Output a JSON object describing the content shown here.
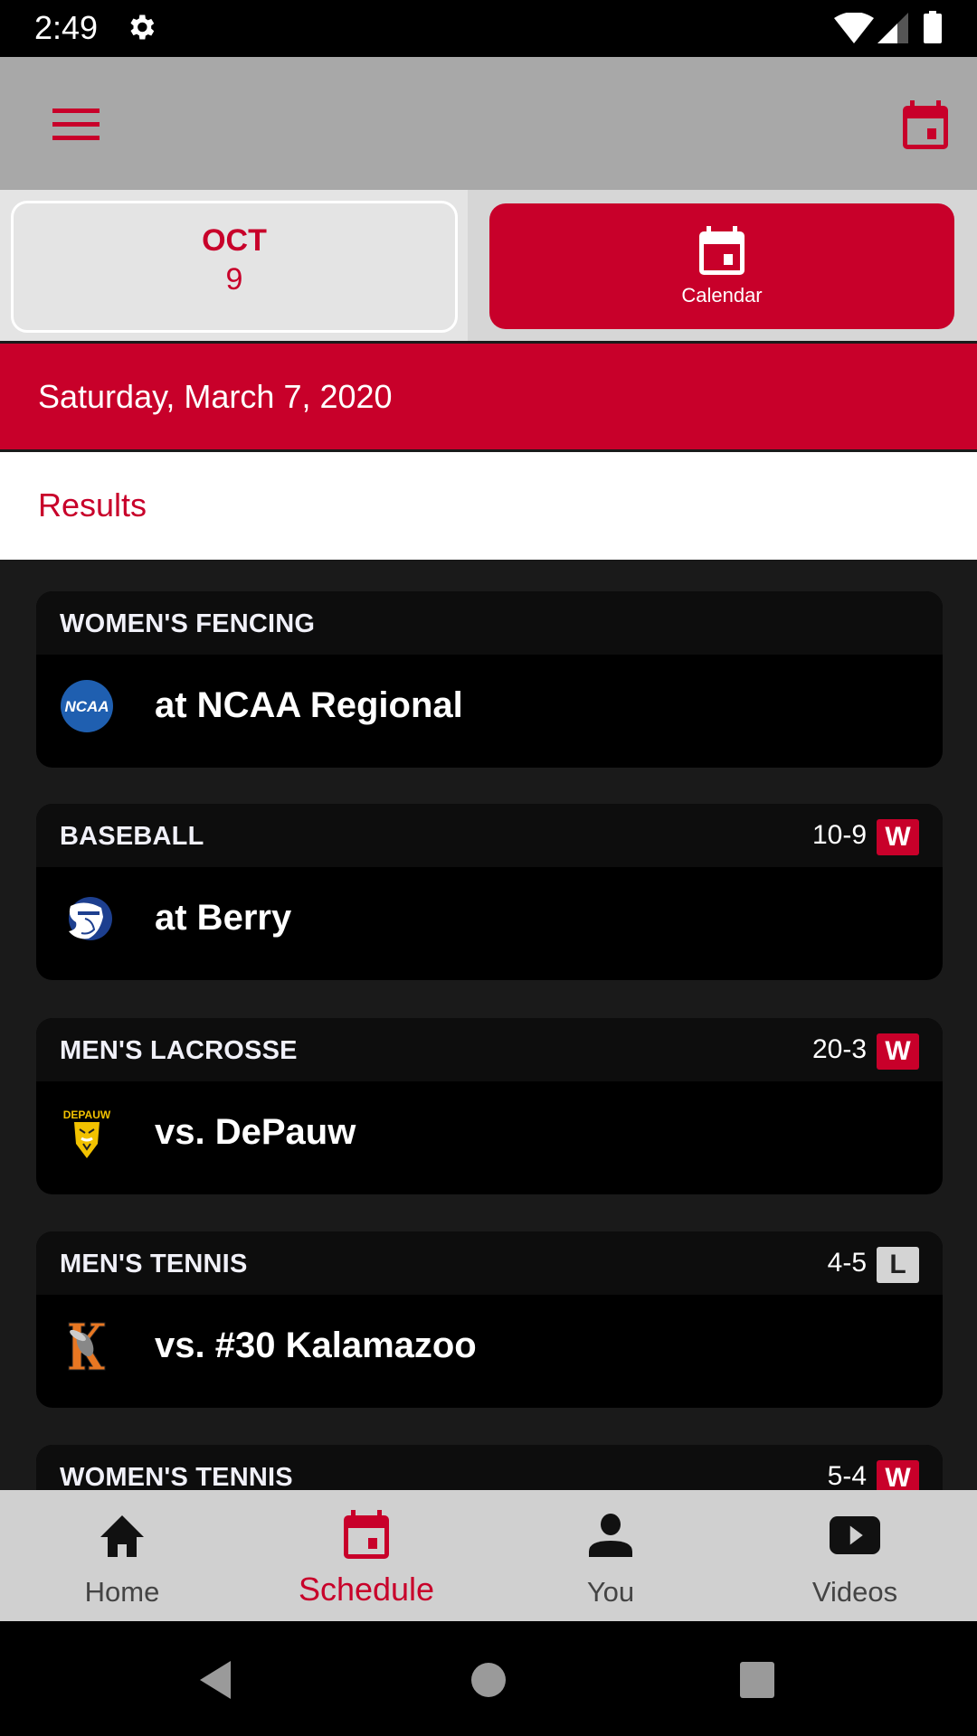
{
  "status_bar": {
    "time": "2:49",
    "icons": [
      "gear-icon",
      "wifi-icon",
      "cell-signal-icon",
      "battery-icon"
    ]
  },
  "app_bar": {
    "left_icon": "hamburger-menu-icon",
    "right_icon": "calendar-icon"
  },
  "date_selector": {
    "month": "OCT",
    "day": "9",
    "calendar_button_label": "Calendar"
  },
  "selected_date": "Saturday, March 7, 2020",
  "section_title": "Results",
  "colors": {
    "accent": "#c8002a",
    "app_bar": "#a8a8a8",
    "content_bg": "#1a1a1a",
    "win_badge": "#c8002a",
    "loss_badge": "#d4d4d4"
  },
  "games": [
    {
      "sport": "WOMEN'S FENCING",
      "score": "",
      "result": "",
      "opponent": "at NCAA Regional",
      "logo": "ncaa-logo"
    },
    {
      "sport": "BASEBALL",
      "score": "10-9",
      "result": "W",
      "opponent": "at Berry",
      "logo": "berry-vikings-logo"
    },
    {
      "sport": "MEN'S LACROSSE",
      "score": "20-3",
      "result": "W",
      "opponent": "vs. DePauw",
      "logo": "depauw-tigers-logo"
    },
    {
      "sport": "MEN'S TENNIS",
      "score": "4-5",
      "result": "L",
      "opponent": "vs. #30 Kalamazoo",
      "logo": "kalamazoo-hornets-logo"
    },
    {
      "sport": "WOMEN'S TENNIS",
      "score": "5-4",
      "result": "W",
      "opponent": "",
      "logo": ""
    }
  ],
  "logo_text": {
    "ncaa": "NCAA",
    "depauw": "DEPAUW"
  },
  "bottom_nav": [
    {
      "label": "Home",
      "icon": "home-icon",
      "active": false
    },
    {
      "label": "Schedule",
      "icon": "calendar-icon",
      "active": true
    },
    {
      "label": "You",
      "icon": "person-icon",
      "active": false
    },
    {
      "label": "Videos",
      "icon": "play-video-icon",
      "active": false
    }
  ],
  "system_nav": [
    "back-button",
    "home-button",
    "recents-button"
  ]
}
